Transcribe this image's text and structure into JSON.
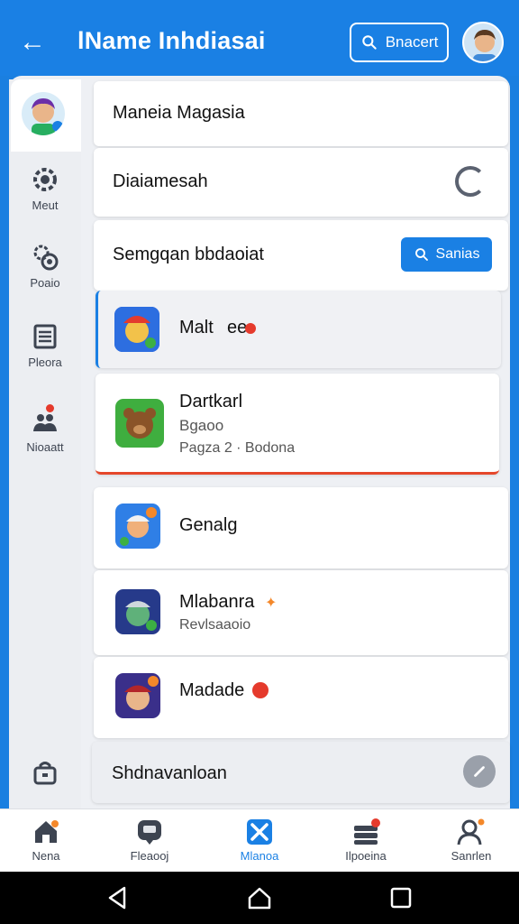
{
  "header": {
    "title": "lName Inhdiasai",
    "search_label": "Bnacert"
  },
  "rail": {
    "items": [
      {
        "label": "Meut",
        "icon": "gear-icon"
      },
      {
        "label": "Poaio",
        "icon": "settings-cog-icon"
      },
      {
        "label": "Pleora",
        "icon": "document-icon"
      },
      {
        "label": "Nioaatt",
        "icon": "people-icon"
      }
    ]
  },
  "cards": {
    "card1_title": "Maneia Magasia",
    "card2_title": "Diaiamesah",
    "section_title": "Semgqan bbdaoiat",
    "section_button": "Sanias",
    "apps": [
      {
        "name": "Malt",
        "tag": "ee",
        "sub1": "",
        "sub2": ""
      },
      {
        "name": "Dartkarl",
        "sub1": "Bgaoo",
        "sub2": "Pagza 2 · Bodona"
      },
      {
        "name": "Genalg",
        "sub1": "",
        "sub2": ""
      },
      {
        "name": "Mlabanra",
        "sub1": "Revlsaaoio",
        "sub2": ""
      },
      {
        "name": "Madade",
        "sub1": "",
        "sub2": ""
      }
    ],
    "footer_title": "Shdnavanloan"
  },
  "bottom_nav": {
    "items": [
      {
        "label": "Nena"
      },
      {
        "label": "Fleaooj"
      },
      {
        "label": "Mlanoa"
      },
      {
        "label": "Ilpoeina"
      },
      {
        "label": "Sanrlen"
      }
    ]
  },
  "colors": {
    "primary": "#1a80e4",
    "badge_red": "#e53a2c",
    "accent_orange": "#f4882a"
  }
}
